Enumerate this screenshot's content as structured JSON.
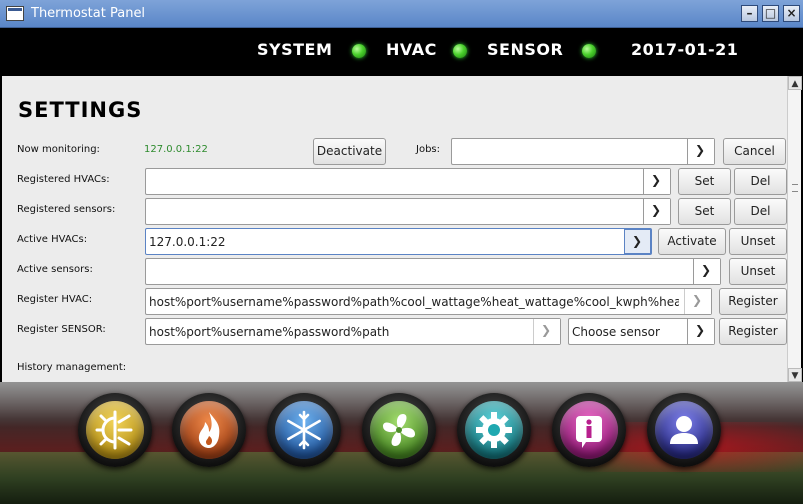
{
  "window": {
    "title": "Thermostat Panel"
  },
  "statusbar": {
    "system_label": "SYSTEM",
    "hvac_label": "HVAC",
    "sensor_label": "SENSOR",
    "date": "2017-01-21",
    "led_color": "#4bd12d"
  },
  "settings": {
    "heading": "SETTINGS",
    "now_monitoring": {
      "label": "Now monitoring:",
      "value": "127.0.0.1:22",
      "button": "Deactivate"
    },
    "jobs": {
      "label": "Jobs:",
      "value": "",
      "button": "Cancel"
    },
    "registered_hvacs": {
      "label": "Registered HVACs:",
      "value": "",
      "set_button": "Set",
      "del_button": "Del"
    },
    "registered_sensors": {
      "label": "Registered sensors:",
      "value": "",
      "set_button": "Set",
      "del_button": "Del"
    },
    "active_hvacs": {
      "label": "Active HVACs:",
      "value": "127.0.0.1:22",
      "activate_button": "Activate",
      "unset_button": "Unset"
    },
    "active_sensors": {
      "label": "Active sensors:",
      "value": "",
      "unset_button": "Unset"
    },
    "register_hvac": {
      "label": "Register HVAC:",
      "value": "host%port%username%password%path%cool_wattage%heat_wattage%cool_kwph%heat_kwph",
      "button": "Register"
    },
    "register_sensor": {
      "label": "Register SENSOR:",
      "value": "host%port%username%password%path",
      "type_value": "Choose sensor",
      "button": "Register"
    },
    "history": {
      "label": "History management:"
    }
  },
  "iconbar": {
    "buttons": [
      {
        "name": "sun-snowflake",
        "color": "#c9a21a"
      },
      {
        "name": "flame",
        "color": "#c4581d"
      },
      {
        "name": "snowflake",
        "color": "#2a73c4"
      },
      {
        "name": "fan",
        "color": "#6cb43a"
      },
      {
        "name": "gear",
        "color": "#1fa8b0"
      },
      {
        "name": "info",
        "color": "#b8208e"
      },
      {
        "name": "user",
        "color": "#3d3fb0"
      }
    ]
  }
}
